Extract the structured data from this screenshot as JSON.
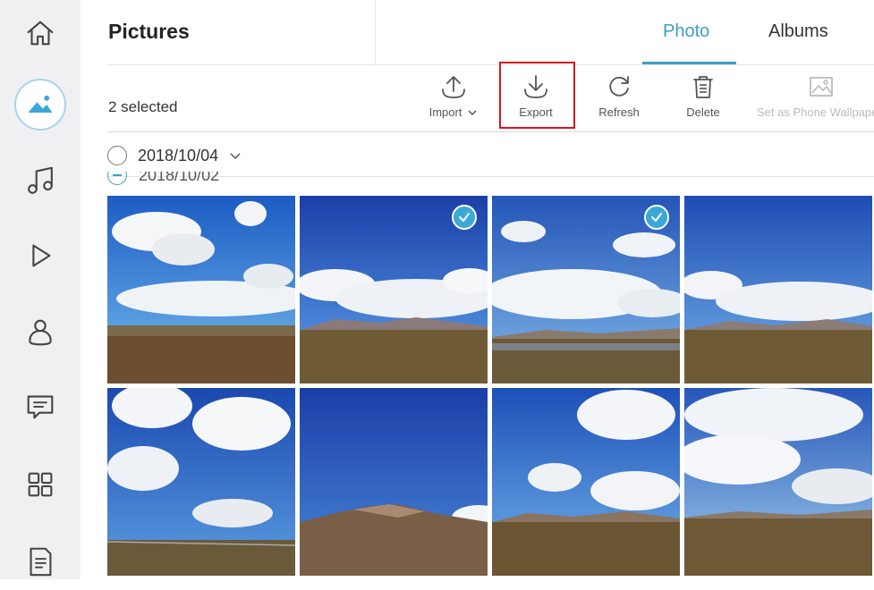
{
  "sidebar": {
    "items": [
      {
        "name": "home-icon",
        "active": false
      },
      {
        "name": "pictures-icon",
        "active": true
      },
      {
        "name": "music-icon",
        "active": false
      },
      {
        "name": "video-icon",
        "active": false
      },
      {
        "name": "contacts-icon",
        "active": false
      },
      {
        "name": "messages-icon",
        "active": false
      },
      {
        "name": "apps-icon",
        "active": false
      },
      {
        "name": "files-icon",
        "active": false
      }
    ]
  },
  "header": {
    "title": "Pictures",
    "tabs": [
      {
        "label": "Photo",
        "active": true
      },
      {
        "label": "Albums",
        "active": false
      }
    ]
  },
  "toolbar": {
    "selected_text": "2 selected",
    "import_label": "Import",
    "export_label": "Export",
    "refresh_label": "Refresh",
    "delete_label": "Delete",
    "wallpaper_label": "Set as Phone Wallpaper"
  },
  "groups": [
    {
      "date": "2018/10/04"
    },
    {
      "date": "2018/10/02"
    }
  ],
  "photos": [
    {
      "selected": false
    },
    {
      "selected": true
    },
    {
      "selected": true
    },
    {
      "selected": false
    },
    {
      "selected": false
    },
    {
      "selected": false
    },
    {
      "selected": false
    },
    {
      "selected": false
    }
  ],
  "colors": {
    "accent": "#3a9fc4",
    "highlight_border": "#d0191e",
    "sidebar_bg": "#f0f0f2",
    "check_badge": "#3aa8d8"
  }
}
